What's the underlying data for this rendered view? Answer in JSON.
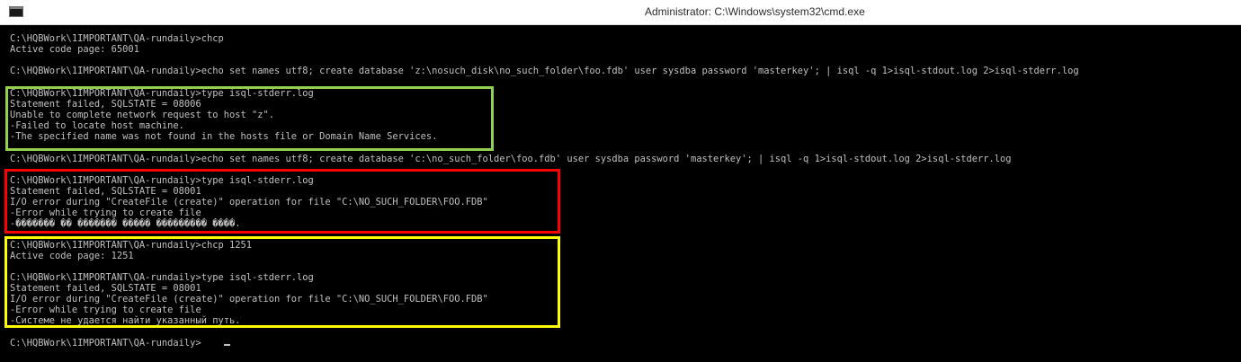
{
  "window": {
    "title": "Administrator: C:\\Windows\\system32\\cmd.exe",
    "icon": "cmd-icon"
  },
  "console": {
    "background": "#000000",
    "foreground": "#c0c0c0",
    "lines": [
      "C:\\HQBWork\\1IMPORTANT\\QA-rundaily>chcp",
      "Active code page: 65001",
      "C:\\HQBWork\\1IMPORTANT\\QA-rundaily>echo set names utf8; create database 'z:\\nosuch_disk\\no_such_folder\\foo.fdb' user sysdba password 'masterkey'; | isql -q 1>isql-stdout.log 2>isql-stderr.log",
      "C:\\HQBWork\\1IMPORTANT\\QA-rundaily>type isql-stderr.log",
      "Statement failed, SQLSTATE = 08006",
      "Unable to complete network request to host \"z\".",
      "-Failed to locate host machine.",
      "-The specified name was not found in the hosts file or Domain Name Services.",
      "C:\\HQBWork\\1IMPORTANT\\QA-rundaily>echo set names utf8; create database 'c:\\no_such_folder\\foo.fdb' user sysdba password 'masterkey'; | isql -q 1>isql-stdout.log 2>isql-stderr.log",
      "C:\\HQBWork\\1IMPORTANT\\QA-rundaily>type isql-stderr.log",
      "Statement failed, SQLSTATE = 08001",
      "I/O error during \"CreateFile (create)\" operation for file \"C:\\NO_SUCH_FOLDER\\FOO.FDB\"",
      "-Error while trying to create file",
      "-������� �� ������� ����� ��������� ����.",
      "C:\\HQBWork\\1IMPORTANT\\QA-rundaily>chcp 1251",
      "Active code page: 1251",
      "C:\\HQBWork\\1IMPORTANT\\QA-rundaily>type isql-stderr.log",
      "Statement failed, SQLSTATE = 08001",
      "I/O error during \"CreateFile (create)\" operation for file \"C:\\NO_SUCH_FOLDER\\FOO.FDB\"",
      "-Error while trying to create file",
      "-Системе не удается найти указанный путь.",
      "C:\\HQBWork\\1IMPORTANT\\QA-rundaily>"
    ]
  },
  "highlights": {
    "green": "#92d050",
    "red": "#ff0000",
    "yellow": "#ffff00"
  }
}
